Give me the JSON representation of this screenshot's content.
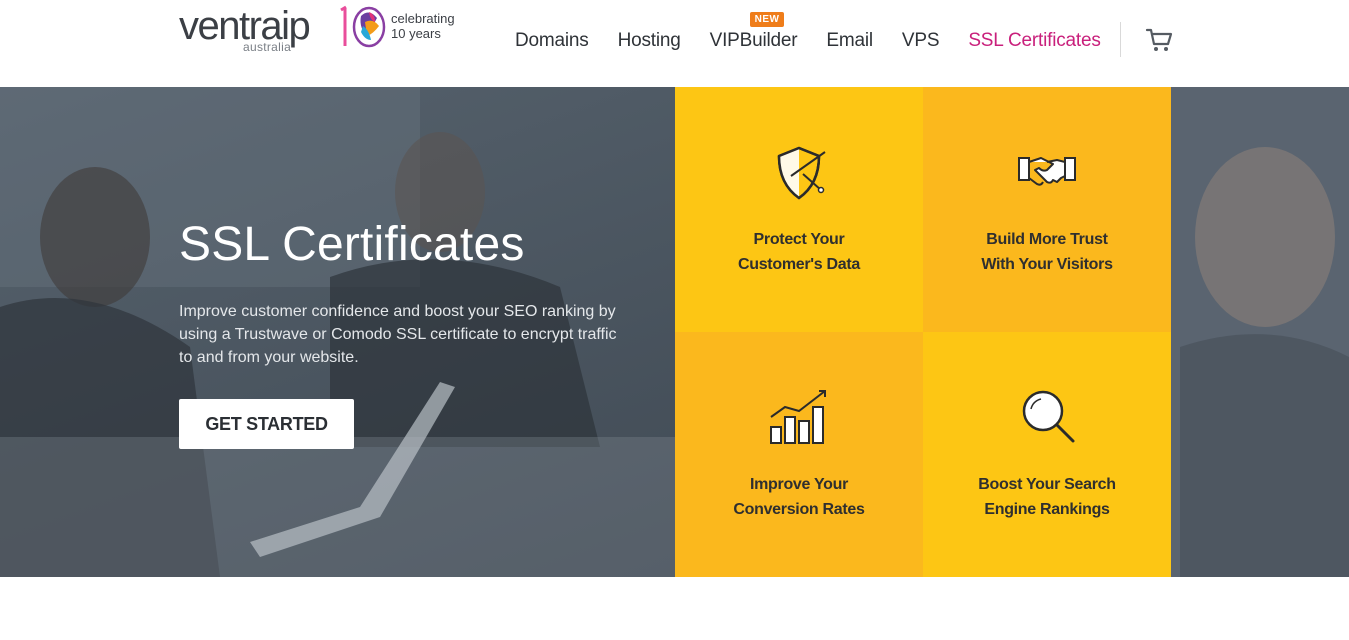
{
  "logo": {
    "word_main": "ventra",
    "word_ip": "ip",
    "sub": "australia",
    "celebrate_line1": "celebrating",
    "celebrate_line2": "10 years"
  },
  "nav": {
    "items": [
      {
        "label": "Domains"
      },
      {
        "label": "Hosting"
      },
      {
        "label": "VIPBuilder",
        "badge": "NEW"
      },
      {
        "label": "Email"
      },
      {
        "label": "VPS"
      },
      {
        "label": "SSL Certificates",
        "active": true
      }
    ]
  },
  "hero": {
    "title": "SSL Certificates",
    "description": "Improve customer confidence and boost your SEO ranking by using a Trustwave or Comodo SSL certificate to encrypt traffic to and from your website.",
    "cta": "GET STARTED"
  },
  "features": [
    {
      "icon": "shield-icon",
      "line1": "Protect Your",
      "line2": "Customer's Data"
    },
    {
      "icon": "handshake-icon",
      "line1": "Build More Trust",
      "line2": "With Your Visitors"
    },
    {
      "icon": "growth-chart-icon",
      "line1": "Improve Your",
      "line2": "Conversion Rates"
    },
    {
      "icon": "magnifier-icon",
      "line1": "Boost Your Search",
      "line2": "Engine Rankings"
    }
  ],
  "colors": {
    "accent": "#c9207c",
    "badge": "#ef7d1a",
    "tile_light": "#fdc614",
    "tile_dark": "#fbb81d",
    "hero_overlay": "#3d4752"
  }
}
